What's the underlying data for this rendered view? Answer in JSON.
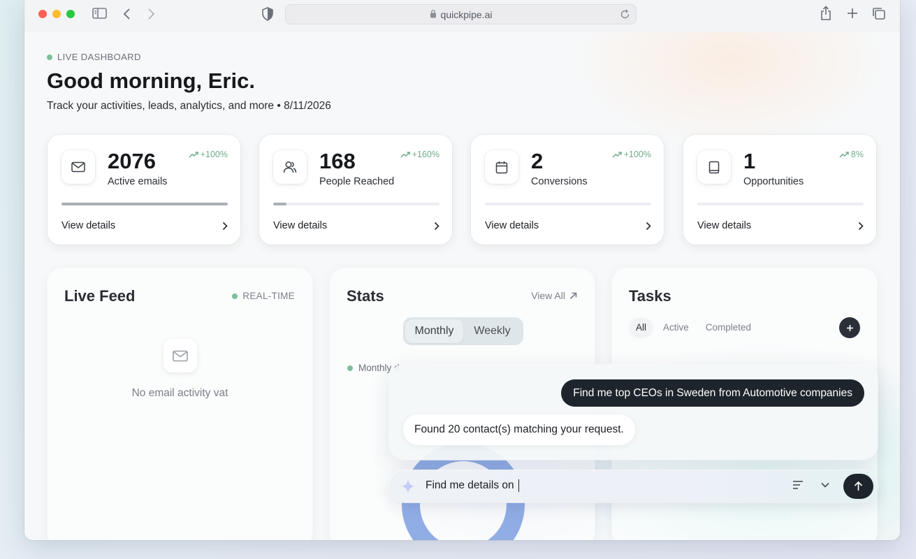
{
  "browser": {
    "url": "quickpipe.ai",
    "icons": [
      "sidebar-icon",
      "back-icon",
      "forward-icon",
      "shield-icon",
      "lock-icon",
      "reload-icon",
      "share-icon",
      "plus-icon",
      "tabs-icon"
    ]
  },
  "header": {
    "live_label": "LIVE DASHBOARD",
    "greeting": "Good morning, Eric.",
    "subtitle": "Track your activities, leads, analytics, and more • 8/11/2026"
  },
  "stats": [
    {
      "value": "2076",
      "label": "Active emails",
      "trend": "+100%",
      "progress": 1.0,
      "icon": "mail-icon",
      "link": "View details"
    },
    {
      "value": "168",
      "label": "People Reached",
      "trend": "+160%",
      "progress": 0.08,
      "icon": "users-icon",
      "link": "View details"
    },
    {
      "value": "2",
      "label": "Conversions",
      "trend": "+100%",
      "progress": 0,
      "icon": "calendar-icon",
      "link": "View details"
    },
    {
      "value": "1",
      "label": "Opportunities",
      "trend": "8%",
      "progress": 0,
      "icon": "book-icon",
      "link": "View details"
    }
  ],
  "live_feed": {
    "title": "Live Feed",
    "badge": "REAL-TIME",
    "empty_text": "No email activity vat"
  },
  "stats_panel": {
    "title": "Stats",
    "view_all": "View All",
    "tabs": [
      "Monthly",
      "Weekly"
    ],
    "active_tab": "Monthly",
    "legend": "Monthly d"
  },
  "tasks": {
    "title": "Tasks",
    "tabs": [
      "All",
      "Active",
      "Completed"
    ],
    "active_tab": "All"
  },
  "chat": {
    "user_message": "Find me top CEOs in Sweden from Automotive companies",
    "bot_message": "Found 20 contact(s) matching your request.",
    "input_value": "Find me details on "
  },
  "colors": {
    "accent_dark": "#1e242b",
    "trend_green": "#6fae8a",
    "live_dot": "#7dbf9b",
    "donut_blue": "#7e9fe0"
  }
}
